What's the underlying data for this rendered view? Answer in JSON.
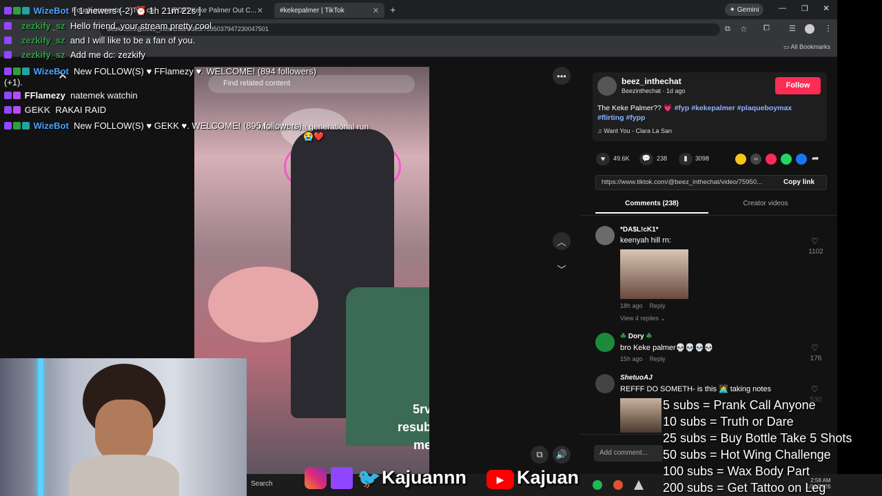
{
  "browser": {
    "tabs": [
      {
        "label": "Rough presenta... - Twit ch"
      },
      {
        "label": "(PDF) Keke Palmer Out C..."
      },
      {
        "label": "#kekepalmer | TikTok"
      }
    ],
    "gemini_label": "Gemini",
    "url": "tiktok.com/@beez_inthechat/video/7595037947230047501",
    "all_bookmarks": "All Bookmarks"
  },
  "stream_overlay": {
    "viewers": "[ 1 viewers (-2)",
    "uptime": "1h 21m 22s ]",
    "chat": [
      {
        "name": "WizeBot",
        "name_color": "#4aa3ff",
        "text": ""
      },
      {
        "name": "zezkify_sz",
        "name_color": "#2ea043",
        "text": "Hello friend, your stream pretty cool"
      },
      {
        "name": "zezkify_sz",
        "name_color": "#2ea043",
        "text": "and I will like to be a fan of you."
      },
      {
        "name": "zezkify_sz",
        "name_color": "#2ea043",
        "text": "Add me dc: zezkify"
      },
      {
        "name": "WizeBot",
        "name_color": "#4aa3ff",
        "text": "New FOLLOW(S) ♥ FFlamezy ♥. WELCOME! (894 followers)"
      },
      {
        "name": "",
        "name_color": "#ffffff",
        "text": "(+1)."
      },
      {
        "name": "FFlamezy",
        "name_color": "#ffffff",
        "text": "natemek watchin"
      },
      {
        "name": "GEKK",
        "name_color": "#bdbdbd",
        "text": "RAKAI RAID"
      },
      {
        "name": "WizeBot",
        "name_color": "#4aa3ff",
        "text": "New FOLLOW(S) ♥ GEKK ♥. WELCOME! (895 followers)"
      }
    ],
    "subs_goals": [
      "5 subs =  Prank Call Anyone",
      "10 subs = Truth or Dare",
      "25 subs = Buy Bottle Take 5 Shots",
      "50 subs = Hot Wing Challenge",
      "100 subs = Wax Body Part",
      "200 subs = Get Tattoo on Leg"
    ],
    "social_handles": [
      "Kajuannn",
      "Kajuan"
    ]
  },
  "video": {
    "search_placeholder": "Find related content",
    "caption_overlay": "Maxwell on a generational run",
    "emoji_row": "😭❤️",
    "side_text": [
      "5rv",
      "resub",
      "me"
    ]
  },
  "post": {
    "username": "beez_inthechat",
    "meta": "Beezinthechat · 1d ago",
    "follow_label": "Follow",
    "caption": "The Keke Palmer?? 💗",
    "hashtags": "#fyp #kekepalmer #plaqueboymax #flirting #fypp",
    "music": "Want You - Clara La San",
    "likes": "49.6K",
    "comments_count": "238",
    "saves": "3098",
    "share_url": "https://www.tiktok.com/@beez_inthechat/video/75950...",
    "copy_link": "Copy link",
    "tab_comments": "Comments (238)",
    "tab_creator": "Creator videos"
  },
  "comments": [
    {
      "name": "*DA$L!cK1*",
      "text": "keenyah hill rn:",
      "time": "18h ago",
      "reply": "Reply",
      "likes": "1102",
      "replies": "View 4 replies"
    },
    {
      "name": "Dory",
      "text": "bro Keke palmer💀💀💀💀",
      "time": "15h ago",
      "reply": "Reply",
      "likes": "176"
    },
    {
      "name": "ShetuoAJ",
      "text": "REFFF DO SOMETH- is this 🧑‍💻 taking notes",
      "likes": "530"
    }
  ],
  "add_comment_placeholder": "Add comment...",
  "taskbar": {
    "search": "Search",
    "time": "2:58 AM",
    "date": "1/16/2026"
  },
  "colors": {
    "tiktok_red": "#fe2c55",
    "twitch_purple": "#9146ff",
    "wizebot_blue": "#4aa3ff"
  }
}
